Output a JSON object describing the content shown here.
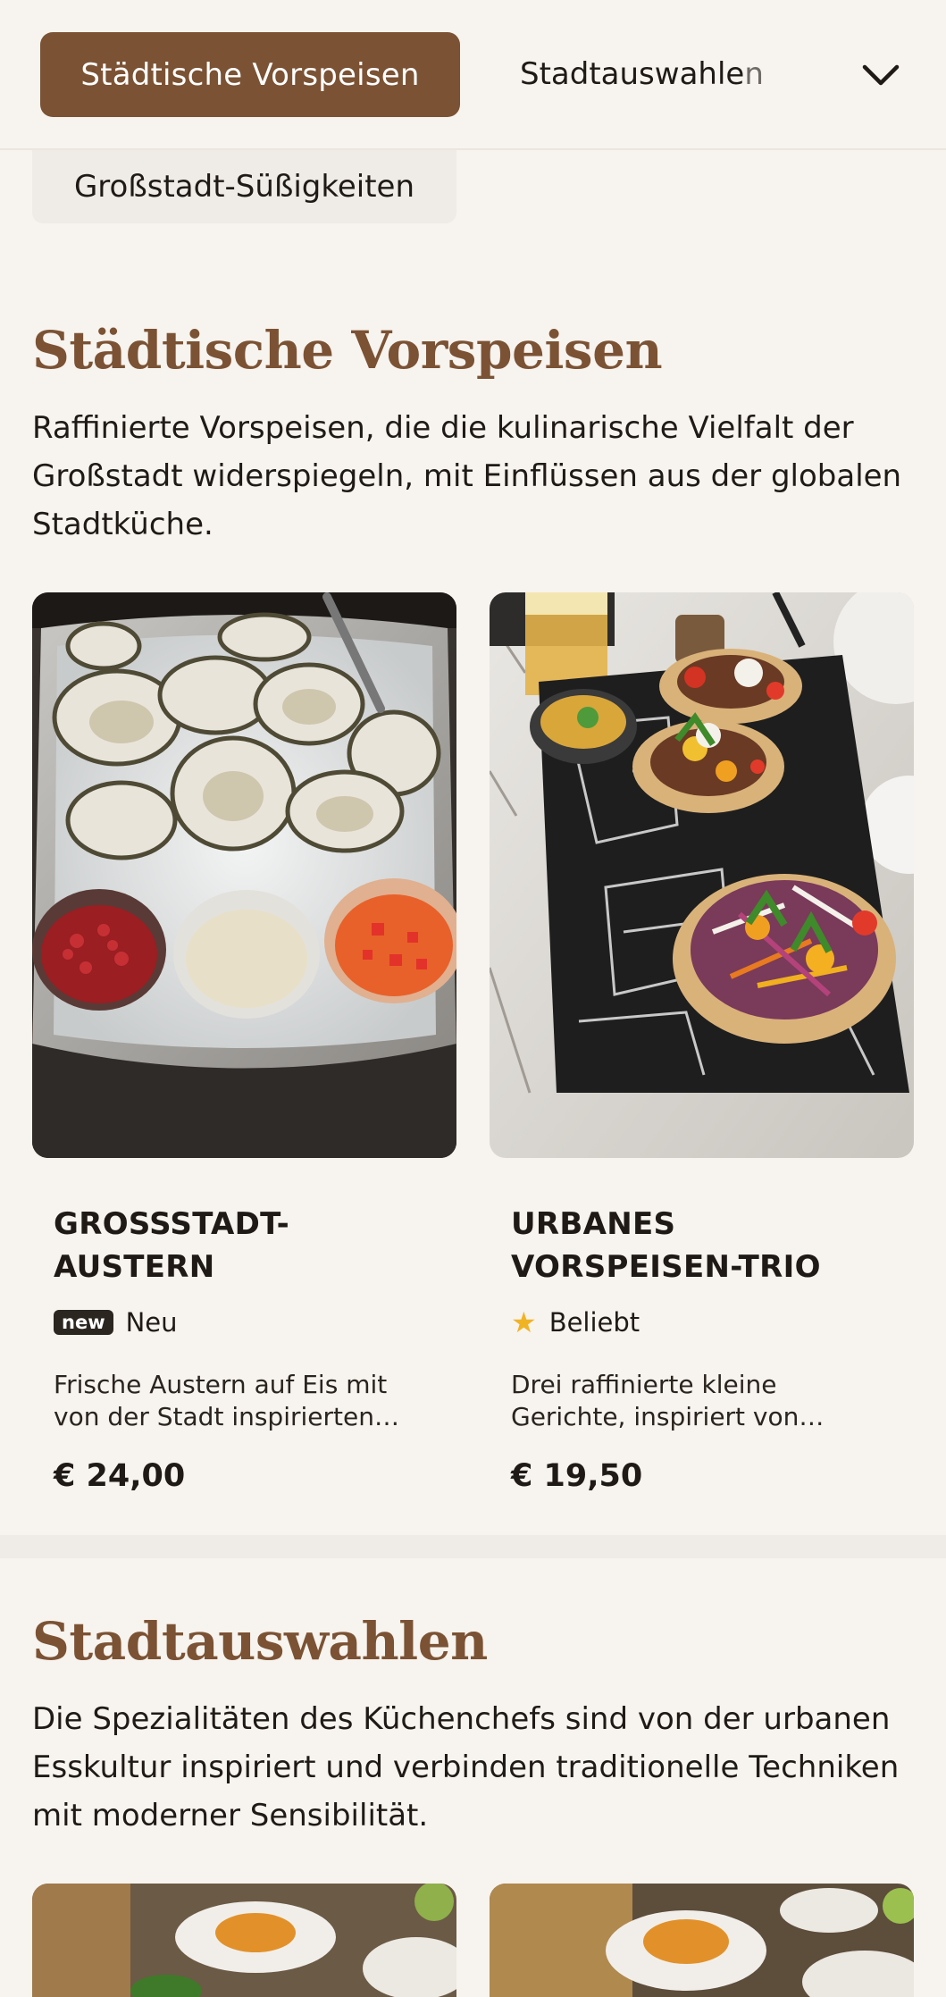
{
  "nav": {
    "active_category": "Städtische Vorspeisen",
    "next_category_main": "Stadtauswahle",
    "next_category_fade": "n",
    "dropdown_category": "Großstadt-Süßigkeiten"
  },
  "sections": [
    {
      "title": "Städtische Vorspeisen",
      "description": "Raffinierte Vorspeisen, die die kulinarische Vielfalt der Großstadt widerspiegeln, mit Einflüssen aus der globalen Stadtküche.",
      "items": [
        {
          "name": "GROSSSTADT-AUSTERN",
          "badge_icon": "new",
          "badge_label": "Neu",
          "description": "Frische Austern auf Eis mit von der Stadt inspirierten…",
          "price": "€ 24,00"
        },
        {
          "name": "URBANES VORSPEISEN-TRIO",
          "badge_icon": "★",
          "badge_label": "Beliebt",
          "description": "Drei raffinierte kleine Gerichte, inspiriert von…",
          "price": "€ 19,50"
        }
      ]
    },
    {
      "title": "Stadtauswahlen",
      "description": "Die Spezialitäten des Küchenchefs sind von der urbanen Esskultur inspiriert und verbinden traditionelle Techniken mit moderner Sensibilität."
    }
  ],
  "colors": {
    "brand": "#7b5234",
    "background": "#f7f3ee",
    "star": "#f0b324"
  }
}
